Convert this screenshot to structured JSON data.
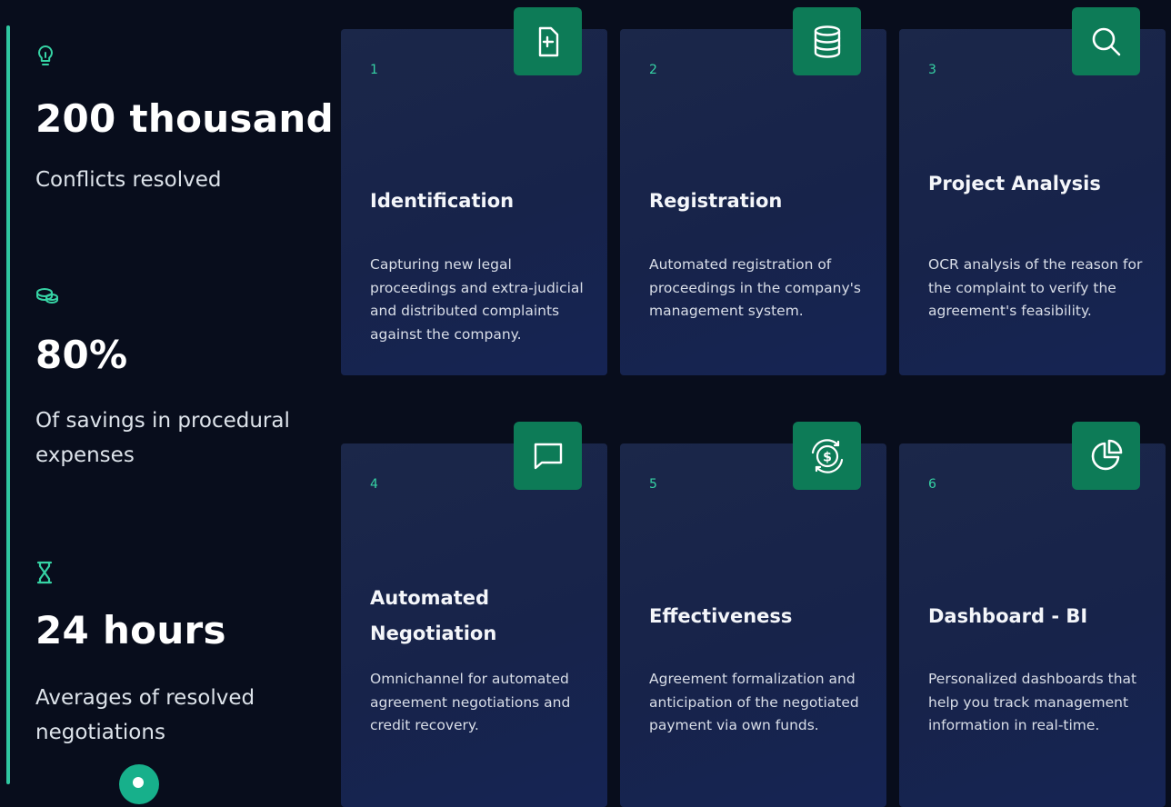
{
  "stats": [
    {
      "icon": "lightbulb-icon",
      "value": "200 thousand",
      "label": "Conflicts resolved"
    },
    {
      "icon": "coins-icon",
      "value": "80%",
      "label": "Of savings in procedural expenses"
    },
    {
      "icon": "hourglass-icon",
      "value": "24 hours",
      "label": "Averages of resolved negotiations"
    }
  ],
  "steps": [
    {
      "number": "1",
      "title": "Identification",
      "icon": "document-icon",
      "description": "Capturing new legal proceedings and extra-judicial and distributed complaints against the company."
    },
    {
      "number": "2",
      "title": "Registration",
      "icon": "database-icon",
      "description": "Automated registration of proceedings in the company's management system."
    },
    {
      "number": "3",
      "title": "Project Analysis",
      "icon": "search-icon",
      "description": "OCR analysis of the reason for the complaint to verify the agreement's feasibility."
    },
    {
      "number": "4",
      "title": "Automated Negotiation",
      "icon": "chat-icon",
      "description": "Omnichannel for automated agreement negotiations and credit recovery."
    },
    {
      "number": "5",
      "title": "Effectiveness",
      "icon": "money-cycle-icon",
      "description": "Agreement formalization and anticipation of the negotiated payment via own funds."
    },
    {
      "number": "6",
      "title": "Dashboard - BI",
      "icon": "pie-chart-icon",
      "description": "Personalized dashboards that help you track management information in real-time."
    }
  ],
  "colors": {
    "background": "#080d1c",
    "accent": "#2fc7a1",
    "icon_tile": "#0d7b57",
    "card": "#1b2749"
  }
}
